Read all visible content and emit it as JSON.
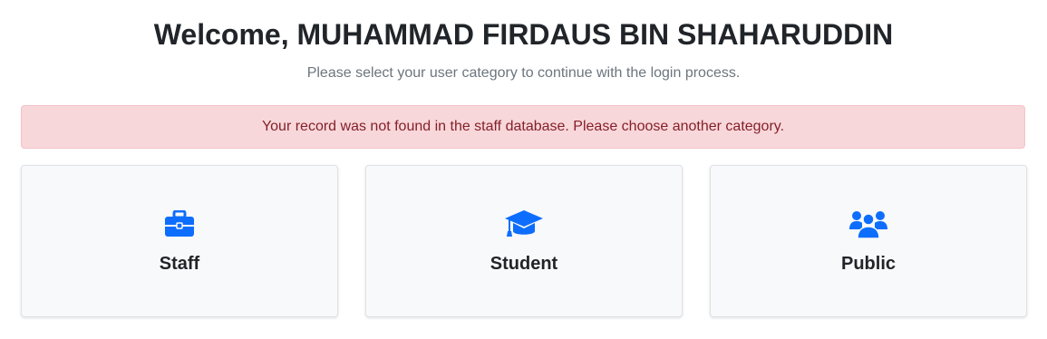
{
  "header": {
    "title": "Welcome, MUHAMMAD FIRDAUS BIN SHAHARUDDIN",
    "subtitle": "Please select your user category to continue with the login process."
  },
  "alert": {
    "message": "Your record was not found in the staff database. Please choose another category."
  },
  "categories": [
    {
      "label": "Staff",
      "icon": "briefcase-icon"
    },
    {
      "label": "Student",
      "icon": "graduation-cap-icon"
    },
    {
      "label": "Public",
      "icon": "users-icon"
    }
  ],
  "colors": {
    "accent": "#0d6efd",
    "alert_bg": "#f8d7da",
    "alert_text": "#842029",
    "card_bg": "#f8f9fa"
  }
}
